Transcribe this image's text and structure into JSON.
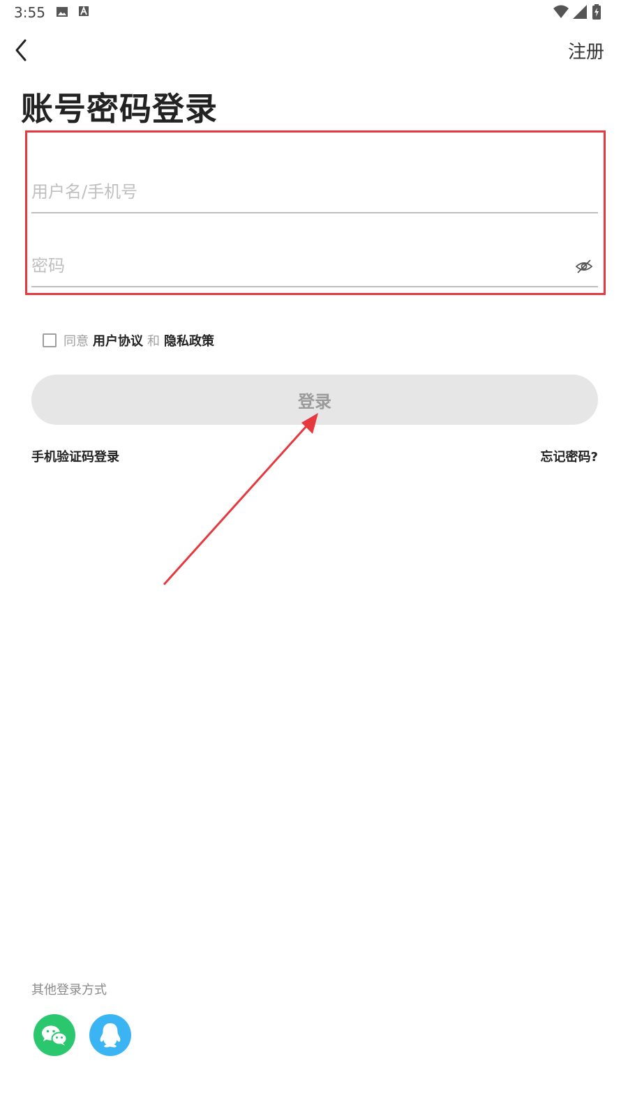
{
  "status_bar": {
    "time": "3:55"
  },
  "nav": {
    "register_label": "注册"
  },
  "title": "账号密码登录",
  "form": {
    "username_placeholder": "用户名/手机号",
    "password_placeholder": "密码"
  },
  "agreement": {
    "prefix": "同意",
    "user_agreement": "用户协议",
    "conjunction": "和",
    "privacy_policy": "隐私政策"
  },
  "login_button_label": "登录",
  "links": {
    "sms_login": "手机验证码登录",
    "forgot_password": "忘记密码?"
  },
  "other_login": {
    "label": "其他登录方式",
    "providers": [
      "wechat-icon",
      "qq-icon"
    ]
  },
  "colors": {
    "highlight": "#e5393f",
    "wechat": "#2bc76f",
    "qq": "#3ab4f2",
    "button_disabled_bg": "#e6e6e6"
  }
}
